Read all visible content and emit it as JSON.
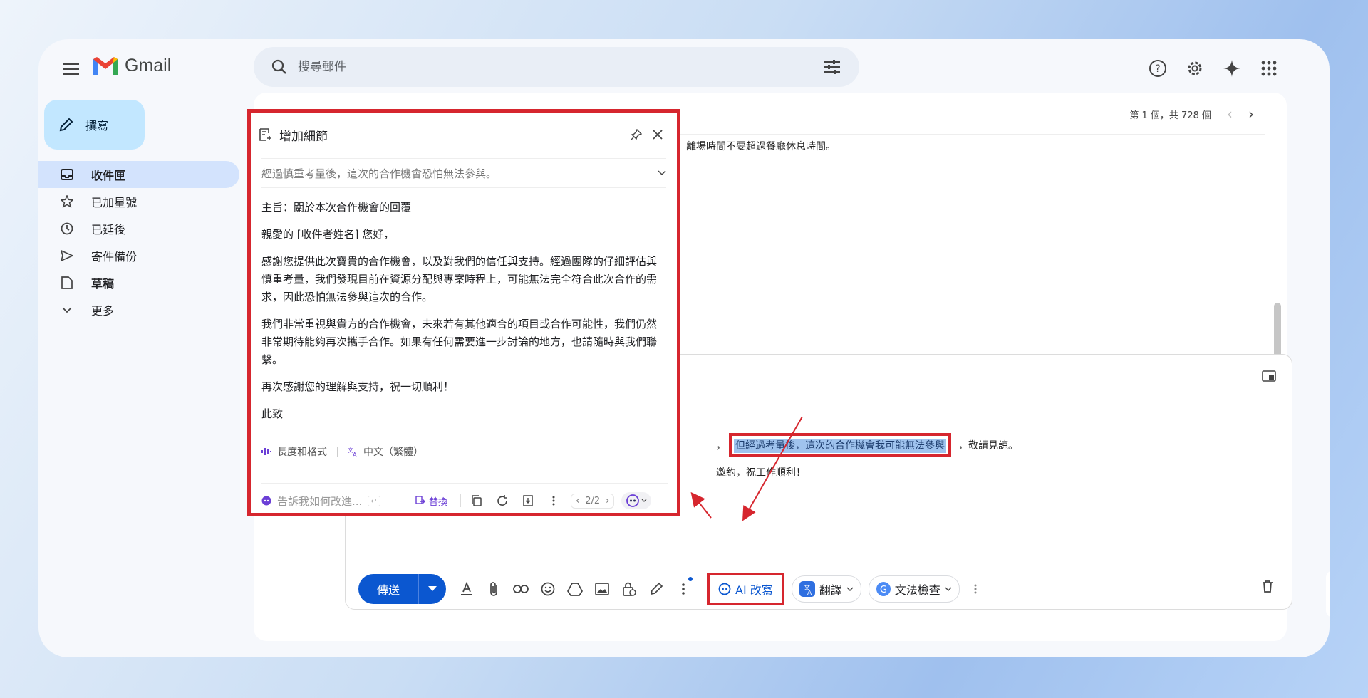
{
  "app": {
    "logo_text": "Gmail"
  },
  "search": {
    "placeholder": "搜尋郵件"
  },
  "sidebar": {
    "compose_label": "撰寫",
    "items": [
      {
        "label": "收件匣",
        "icon": "inbox-icon",
        "active": true
      },
      {
        "label": "已加星號",
        "icon": "star-icon"
      },
      {
        "label": "已延後",
        "icon": "clock-icon"
      },
      {
        "label": "寄件備份",
        "icon": "send-icon"
      },
      {
        "label": "草稿",
        "icon": "draft-icon"
      },
      {
        "label": "更多",
        "icon": "chevron-down-icon"
      }
    ]
  },
  "main": {
    "pager_text": "第 1 個，共 728 個",
    "partial_text": "離場時間不要超過餐廳休息時間。"
  },
  "compose": {
    "body_prefix": "，",
    "highlighted_text": "但經過考量後，這次的合作機會我可能無法參與",
    "body_suffix": "，敬請見諒。",
    "body_line2": "邀約，祝工作順利！",
    "send_label": "傳送",
    "ai_button_label": "AI 改寫",
    "translate_label": "翻譯",
    "grammar_label": "文法檢查"
  },
  "popup": {
    "title": "增加細節",
    "selected_text": "經過慎重考量後，這次的合作機會恐怕無法參與。",
    "paragraphs": [
      "主旨：關於本次合作機會的回覆",
      "親愛的 [收件者姓名] 您好，",
      "感謝您提供此次寶貴的合作機會，以及對我們的信任與支持。經過團隊的仔細評估與慎重考量，我們發現目前在資源分配與專案時程上，可能無法完全符合此次合作的需求，因此恐怕無法參與這次的合作。",
      "我們非常重視與貴方的合作機會，未來若有其他適合的項目或合作可能性，我們仍然非常期待能夠再次攜手合作。如果有任何需要進一步討論的地方，也請隨時與我們聯繫。",
      "再次感謝您的理解與支持，祝一切順利！",
      "此致"
    ],
    "length_format_label": "長度和格式",
    "language_label": "中文（繁體）",
    "ask_placeholder": "告訴我如何改進...",
    "replace_label": "替換",
    "page_indicator": "2/2"
  },
  "colors": {
    "accent_blue": "#0b57d0",
    "annotation_red": "#d6262e",
    "highlight": "#9fc3ee",
    "compose_button_bg": "#c2e7ff"
  }
}
